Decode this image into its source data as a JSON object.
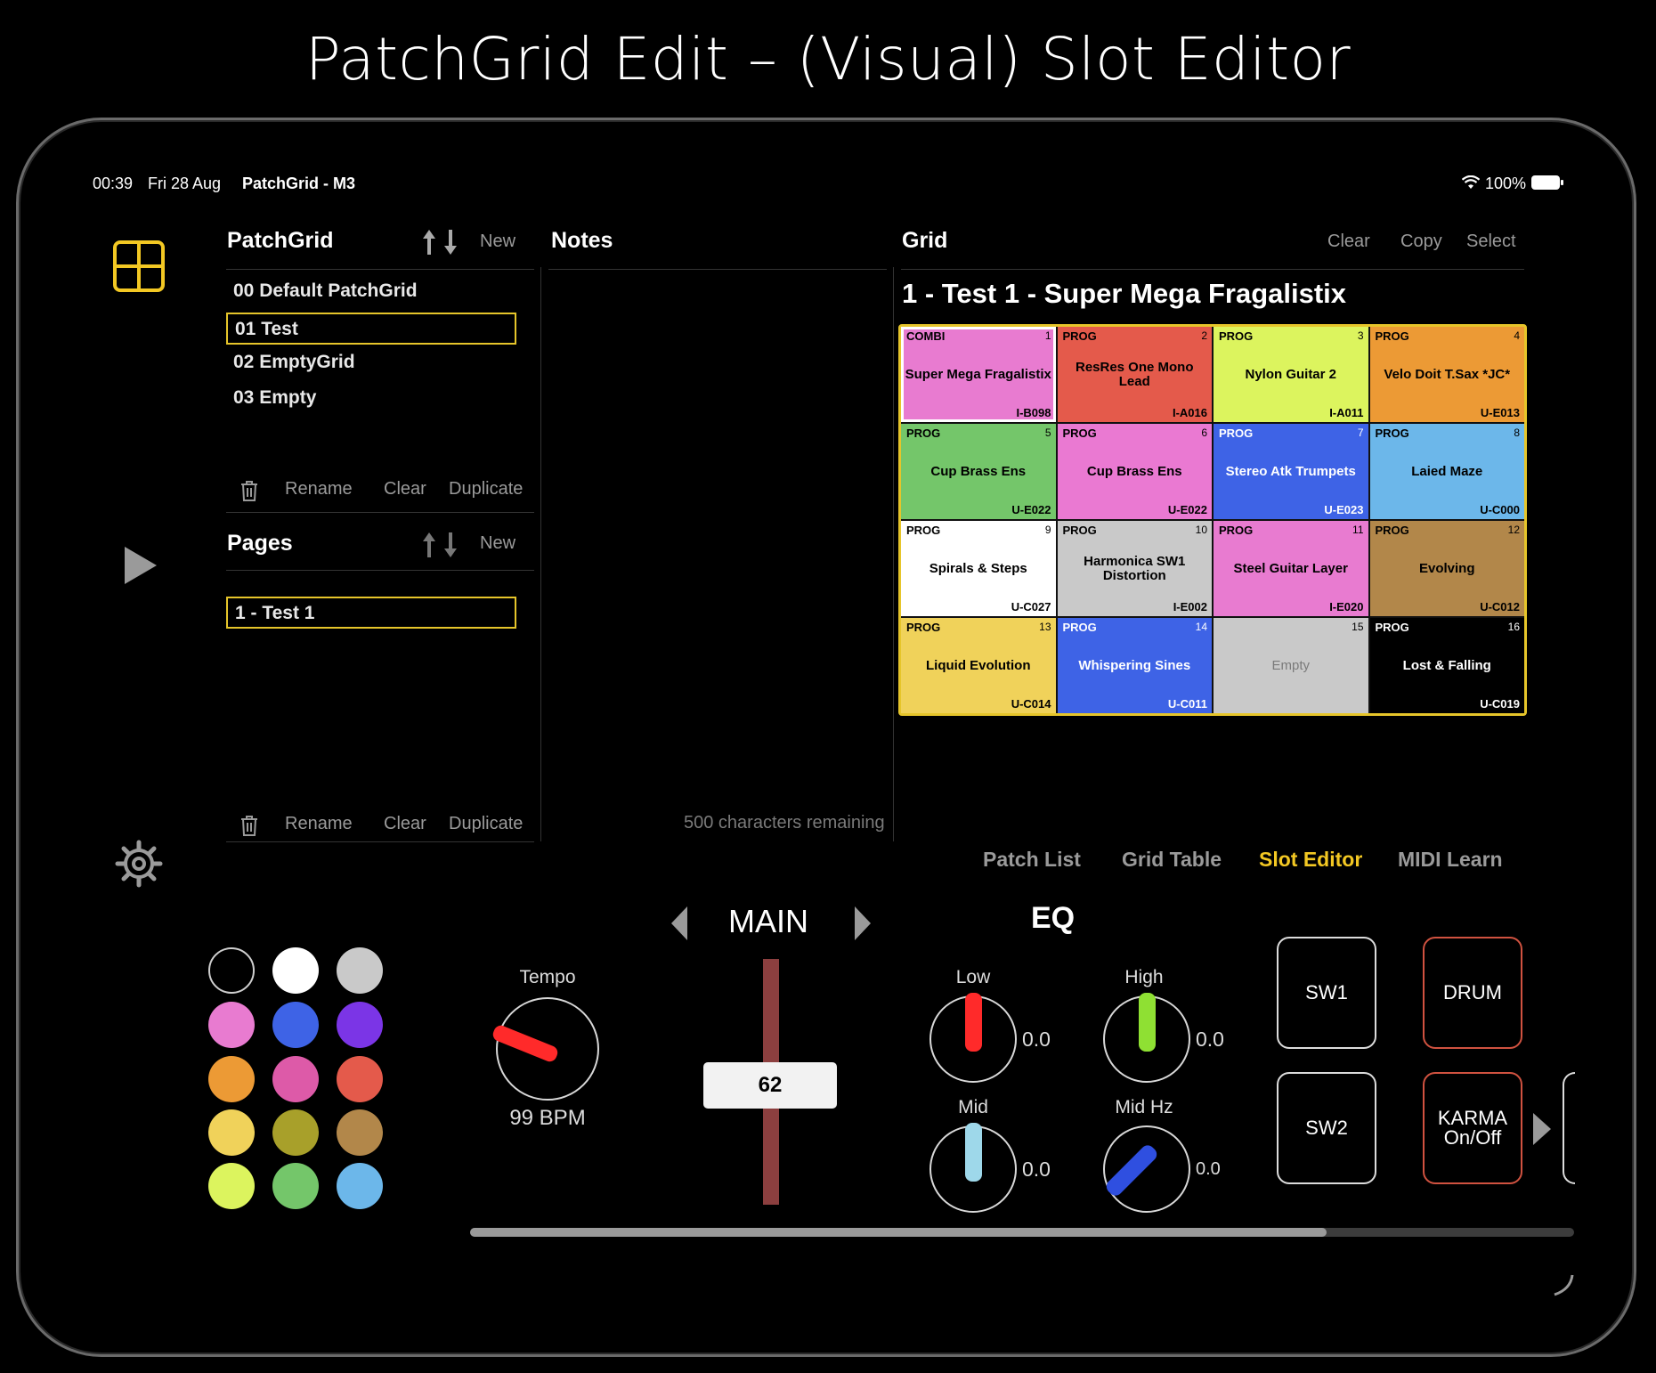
{
  "page_title": "PatchGrid Edit – (Visual) Slot Editor",
  "status_bar": {
    "time": "00:39",
    "date": "Fri 28 Aug",
    "app": "PatchGrid - M3",
    "battery": "100%"
  },
  "patchgrid_panel": {
    "header": "PatchGrid",
    "new_label": "New",
    "items": [
      "00  Default PatchGrid",
      "01  Test",
      "02  EmptyGrid",
      "03  Empty"
    ],
    "selected_index": 1,
    "rename": "Rename",
    "clear": "Clear",
    "duplicate": "Duplicate"
  },
  "pages_panel": {
    "header": "Pages",
    "new_label": "New",
    "items": [
      "1 - Test 1"
    ],
    "rename": "Rename",
    "clear": "Clear",
    "duplicate": "Duplicate"
  },
  "notes_panel": {
    "header": "Notes",
    "remaining": "500 characters remaining"
  },
  "grid_panel": {
    "header": "Grid",
    "clear": "Clear",
    "copy": "Copy",
    "select": "Select",
    "page_title": "1 - Test 1 - Super Mega Fragalistix",
    "cells": [
      {
        "type": "COMBI",
        "num": "1",
        "name": "Super Mega Fragalistix",
        "bank": "I-B098",
        "color": "#e87bd0",
        "selected": true
      },
      {
        "type": "PROG",
        "num": "2",
        "name": "ResRes One Mono Lead",
        "bank": "I-A016",
        "color": "#e45a4b"
      },
      {
        "type": "PROG",
        "num": "3",
        "name": "Nylon Guitar 2",
        "bank": "I-A011",
        "color": "#dcf45e"
      },
      {
        "type": "PROG",
        "num": "4",
        "name": "Velo Doit T.Sax *JC*",
        "bank": "U-E013",
        "color": "#ec9a35"
      },
      {
        "type": "PROG",
        "num": "5",
        "name": "Cup Brass Ens",
        "bank": "U-E022",
        "color": "#74c66a"
      },
      {
        "type": "PROG",
        "num": "6",
        "name": "Cup Brass Ens",
        "bank": "U-E022",
        "color": "#ea79d2"
      },
      {
        "type": "PROG",
        "num": "7",
        "name": "Stereo Atk Trumpets",
        "bank": "U-E023",
        "color": "#3e63e6",
        "light": true
      },
      {
        "type": "PROG",
        "num": "8",
        "name": "Laied Maze",
        "bank": "U-C000",
        "color": "#6cb7ea"
      },
      {
        "type": "PROG",
        "num": "9",
        "name": "Spirals & Steps",
        "bank": "U-C027",
        "color": "#ffffff"
      },
      {
        "type": "PROG",
        "num": "10",
        "name": "Harmonica SW1 Distortion",
        "bank": "I-E002",
        "color": "#c9c9c9"
      },
      {
        "type": "PROG",
        "num": "11",
        "name": "Steel Guitar Layer",
        "bank": "I-E020",
        "color": "#e87bd0"
      },
      {
        "type": "PROG",
        "num": "12",
        "name": "Evolving",
        "bank": "U-C012",
        "color": "#b2874a"
      },
      {
        "type": "PROG",
        "num": "13",
        "name": "Liquid Evolution",
        "bank": "U-C014",
        "color": "#f0d25a"
      },
      {
        "type": "PROG",
        "num": "14",
        "name": "Whispering Sines",
        "bank": "U-C011",
        "color": "#3e63e6",
        "light": true
      },
      {
        "type": "",
        "num": "15",
        "name": "Empty",
        "bank": "",
        "color": "#c9c9c9",
        "muted": true
      },
      {
        "type": "PROG",
        "num": "16",
        "name": "Lost & Falling",
        "bank": "U-C019",
        "color": "#000000",
        "light": true
      }
    ]
  },
  "tabs": [
    {
      "label": "Patch List",
      "active": false
    },
    {
      "label": "Grid Table",
      "active": false
    },
    {
      "label": "Slot Editor",
      "active": true
    },
    {
      "label": "MIDI Learn",
      "active": false
    }
  ],
  "palette": [
    "#000000",
    "#ffffff",
    "#c9c9c9",
    "#e87bd0",
    "#3e63e6",
    "#7b35e6",
    "#ec9a35",
    "#dd5aa8",
    "#e45a4b",
    "#f0d25a",
    "#a8a02a",
    "#b2874a",
    "#dcf45e",
    "#74c66a",
    "#6cb7ea"
  ],
  "controls": {
    "main_label": "MAIN",
    "tempo_label": "Tempo",
    "tempo_value": "99 BPM",
    "fader_value": "62",
    "eq_label": "EQ",
    "low_label": "Low",
    "low_value": "0.0",
    "high_label": "High",
    "high_value": "0.0",
    "mid_label": "Mid",
    "mid_value": "0.0",
    "midhz_label": "Mid Hz",
    "midhz_value": "0.0",
    "sw1": "SW1",
    "sw2": "SW2",
    "drum": "DRUM",
    "karma_line1": "KARMA",
    "karma_line2": "On/Off"
  },
  "colors": {
    "accent": "#f3c823",
    "red_knob": "#ff2a2a",
    "green_knob": "#8fe033",
    "blue_knob": "#2f4fe0",
    "cyan_knob": "#9ed8ea",
    "fader": "#8c3f3f"
  }
}
